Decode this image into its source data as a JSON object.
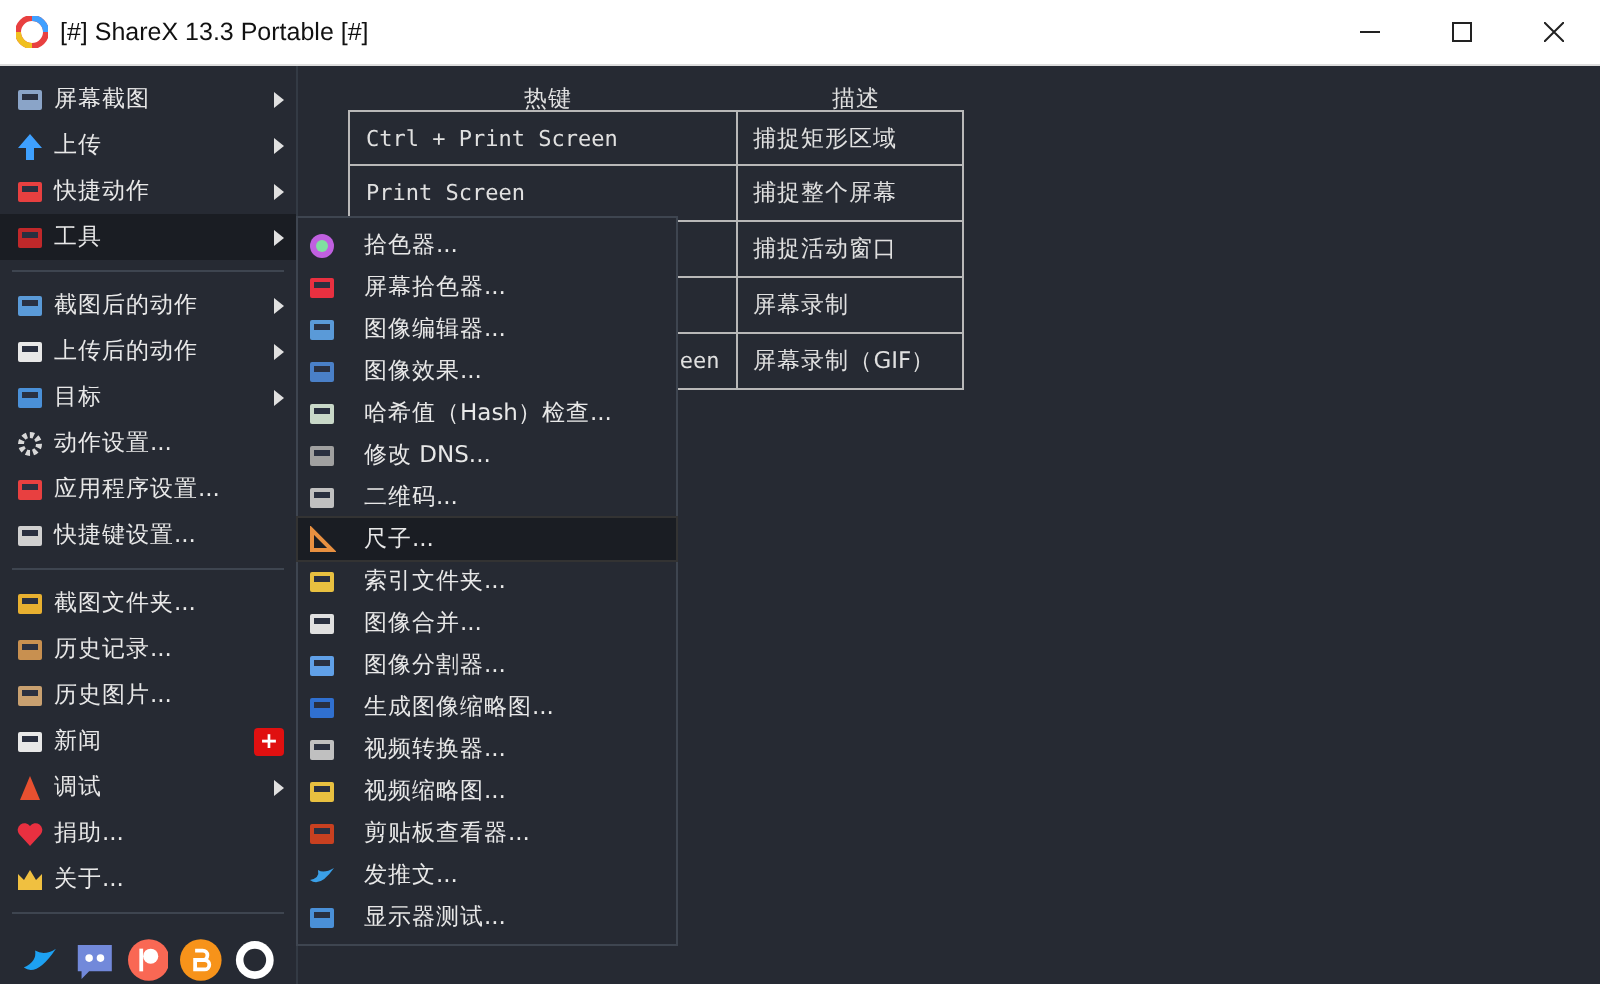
{
  "window": {
    "title": "[#] ShareX 13.3 Portable [#]"
  },
  "main_menu": {
    "groups": [
      [
        {
          "label": "屏幕截图",
          "submenu": true,
          "selected": false
        },
        {
          "label": "上传",
          "submenu": true,
          "selected": false
        },
        {
          "label": "快捷动作",
          "submenu": true,
          "selected": false
        },
        {
          "label": "工具",
          "submenu": true,
          "selected": true
        }
      ],
      [
        {
          "label": "截图后的动作",
          "submenu": true,
          "selected": false
        },
        {
          "label": "上传后的动作",
          "submenu": true,
          "selected": false
        },
        {
          "label": "目标",
          "submenu": true,
          "selected": false
        },
        {
          "label": "动作设置...",
          "submenu": false,
          "selected": false
        },
        {
          "label": "应用程序设置...",
          "submenu": false,
          "selected": false
        },
        {
          "label": "快捷键设置...",
          "submenu": false,
          "selected": false
        }
      ],
      [
        {
          "label": "截图文件夹...",
          "submenu": false,
          "selected": false
        },
        {
          "label": "历史记录...",
          "submenu": false,
          "selected": false
        },
        {
          "label": "历史图片...",
          "submenu": false,
          "selected": false
        },
        {
          "label": "新闻",
          "submenu": false,
          "selected": false,
          "badge": "+"
        },
        {
          "label": "调试",
          "submenu": true,
          "selected": false
        },
        {
          "label": "捐助...",
          "submenu": false,
          "selected": false
        },
        {
          "label": "关于...",
          "submenu": false,
          "selected": false
        }
      ]
    ]
  },
  "tools_submenu": [
    {
      "label": "拾色器...",
      "selected": false
    },
    {
      "label": "屏幕拾色器...",
      "selected": false
    },
    {
      "label": "图像编辑器...",
      "selected": false
    },
    {
      "label": "图像效果...",
      "selected": false
    },
    {
      "label": "哈希值（Hash）检查...",
      "selected": false
    },
    {
      "label": "修改 DNS...",
      "selected": false
    },
    {
      "label": "二维码...",
      "selected": false
    },
    {
      "label": "尺子...",
      "selected": true
    },
    {
      "label": "索引文件夹...",
      "selected": false
    },
    {
      "label": "图像合并...",
      "selected": false
    },
    {
      "label": "图像分割器...",
      "selected": false
    },
    {
      "label": "生成图像缩略图...",
      "selected": false
    },
    {
      "label": "视频转换器...",
      "selected": false
    },
    {
      "label": "视频缩略图...",
      "selected": false
    },
    {
      "label": "剪贴板查看器...",
      "selected": false
    },
    {
      "label": "发推文...",
      "selected": false
    },
    {
      "label": "显示器测试...",
      "selected": false
    }
  ],
  "hotkey_table": {
    "columns": [
      "热键",
      "描述"
    ],
    "rows": [
      {
        "hotkey": "Ctrl + Print Screen",
        "description": "捕捉矩形区域"
      },
      {
        "hotkey": "Print Screen",
        "description": "捕捉整个屏幕"
      },
      {
        "description": "捕捉活动窗口"
      },
      {
        "description": "屏幕录制"
      },
      {
        "hotkey": "een",
        "description": "屏幕录制（GIF）"
      }
    ]
  }
}
